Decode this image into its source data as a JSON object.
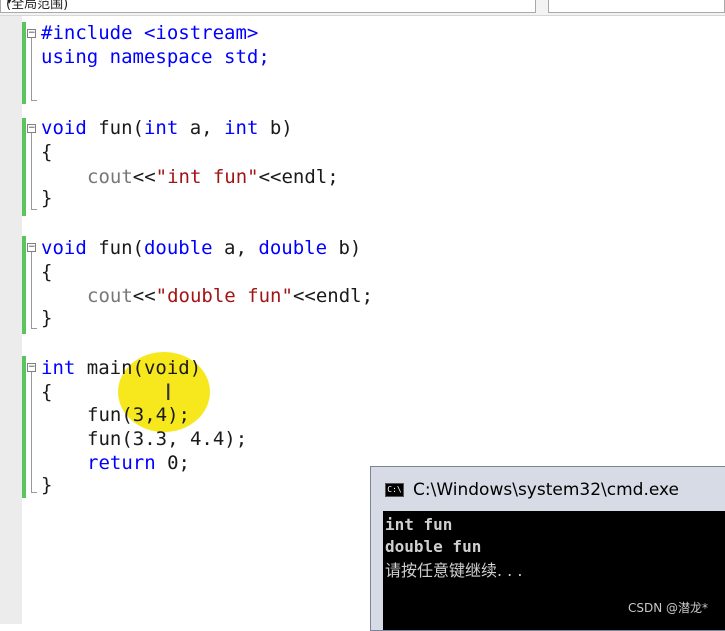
{
  "toolbar": {
    "scope_combo_label": "(全局范围)",
    "arrow": "▾"
  },
  "code": {
    "include": "#include <iostream>",
    "using": "using namespace std;",
    "fun1_sig": {
      "kw_void": "void",
      "mid": " fun(",
      "kw_int1": "int",
      "a": " a, ",
      "kw_int2": "int",
      "b": " b)"
    },
    "open1": "{",
    "cout1": {
      "obj": "cout",
      "op1": "<<",
      "str": "\"int fun\"",
      "op2": "<<endl;"
    },
    "close1": "}",
    "fun2_sig": {
      "kw_void": "void",
      "mid": " fun(",
      "kw_double1": "double",
      "a": " a, ",
      "kw_double2": "double",
      "b": " b)"
    },
    "open2": "{",
    "cout2": {
      "obj": "cout",
      "op1": "<<",
      "str": "\"double fun\"",
      "op2": "<<endl;"
    },
    "close2": "}",
    "main_sig": {
      "kw_int": "int",
      "rest": " main(void)"
    },
    "open3": "{",
    "call1": "fun(3,4);",
    "call2": "fun(3.3, 4.4);",
    "ret": {
      "kw_return": "return",
      "rest": " 0;"
    },
    "close3": "}"
  },
  "console": {
    "title": "C:\\Windows\\system32\\cmd.exe",
    "icon_text": "C:\\",
    "lines": [
      "int fun",
      "double fun",
      "请按任意键继续. . ."
    ]
  },
  "watermark": "CSDN @潜龙*"
}
